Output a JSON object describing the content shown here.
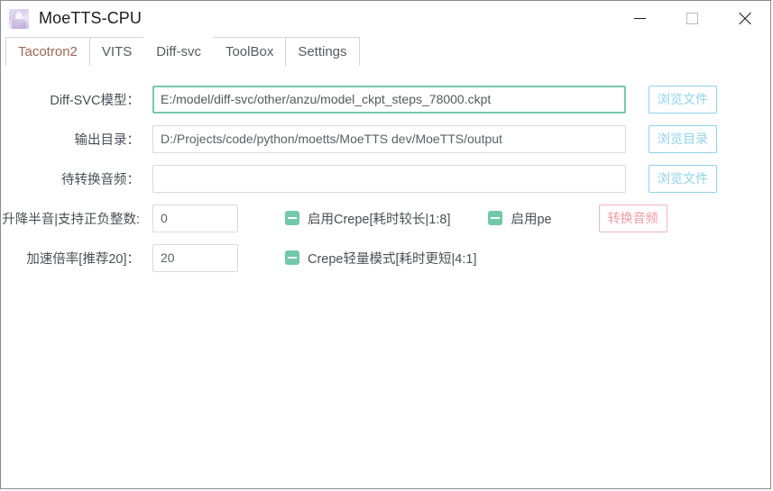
{
  "window": {
    "title": "MoeTTS-CPU",
    "icon": "app-avatar-icon",
    "controls": {
      "minimize": "minimize-icon",
      "maximize": "maximize-icon",
      "close": "close-icon"
    }
  },
  "tabs": [
    {
      "label": "Tacotron2",
      "active": false
    },
    {
      "label": "VITS",
      "active": false
    },
    {
      "label": "Diff-svc",
      "active": true
    },
    {
      "label": "ToolBox",
      "active": false
    },
    {
      "label": "Settings",
      "active": false
    }
  ],
  "form": {
    "rows": [
      {
        "label": "Diff-SVC模型：",
        "value": "E:/model/diff-svc/other/anzu/model_ckpt_steps_78000.ckpt",
        "placeholder": "",
        "button": "浏览文件"
      },
      {
        "label": "输出目录：",
        "value": "D:/Projects/code/python/moetts/MoeTTS dev/MoeTTS/output",
        "placeholder": "",
        "button": "浏览目录"
      },
      {
        "label": "待转换音频：",
        "value": "",
        "placeholder": "",
        "button": "浏览文件"
      }
    ],
    "pitch": {
      "label": "升降半音|支持正负整数:",
      "value": "0"
    },
    "speed": {
      "label": "加速倍率[推荐20]：",
      "value": "20"
    },
    "convert_button": "转换音频"
  },
  "checkboxes": [
    {
      "label": "启用Crepe[耗时较长|1:8]",
      "checked": true
    },
    {
      "label": "启用pe",
      "checked": true
    },
    {
      "label": "Crepe轻量模式[耗时更短|4:1]",
      "checked": true
    }
  ],
  "colors": {
    "focus_border": "#76c7aa",
    "checkbox_fill": "#71c9a8",
    "browse_button": "#8ed2ea",
    "convert_button": "#f09aa4",
    "tab_text": "#555a60",
    "first_tab_text": "#9a6a52"
  }
}
